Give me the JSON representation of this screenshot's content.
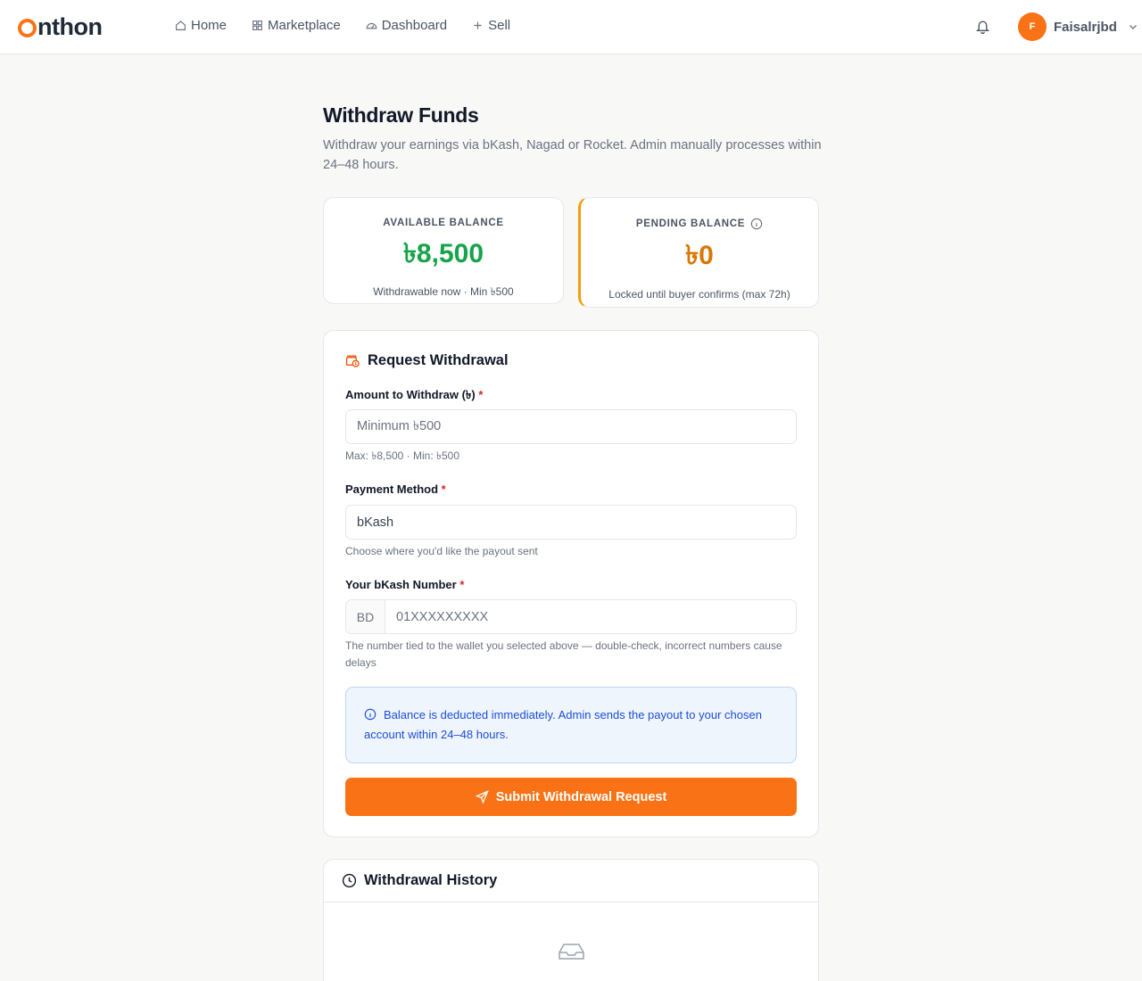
{
  "header": {
    "logo_rest": "nthon",
    "nav": [
      {
        "label": "Home",
        "icon": "home-icon"
      },
      {
        "label": "Marketplace",
        "icon": "grid-icon"
      },
      {
        "label": "Dashboard",
        "icon": "gauge-icon"
      },
      {
        "label": "Sell",
        "icon": "plus-icon"
      }
    ],
    "avatar_initial": "F",
    "user_name": "Faisalrjbd"
  },
  "page": {
    "title": "Withdraw Funds",
    "subtitle": "Withdraw your earnings via bKash, Nagad or Rocket. Admin manually processes within 24–48 hours."
  },
  "balances": {
    "available": {
      "label": "AVAILABLE BALANCE",
      "amount": "৳8,500",
      "note": "Withdrawable now · Min ৳500",
      "color": "#16a34a"
    },
    "pending": {
      "label": "PENDING BALANCE",
      "amount": "৳0",
      "note": "Locked until buyer confirms (max 72h)",
      "color": "#d97706",
      "accent": "#f59e0b"
    }
  },
  "form": {
    "title": "Request Withdrawal",
    "amount_label": "Amount to Withdraw (৳)",
    "amount_placeholder": "Minimum ৳500",
    "amount_hint": "Max: ৳8,500 · Min: ৳500",
    "method_label": "Payment Method",
    "method_value": "bKash",
    "method_hint": "Choose where you'd like the payout sent",
    "number_label": "Your bKash Number",
    "number_prefix": "BD",
    "number_placeholder": "01XXXXXXXXX",
    "number_hint": "The number tied to the wallet you selected above — double-check, incorrect numbers cause delays",
    "required_mark": "*",
    "notice": "Balance is deducted immediately. Admin sends the payout to your chosen account within 24–48 hours.",
    "submit_label": "Submit Withdrawal Request"
  },
  "history": {
    "title": "Withdrawal History"
  },
  "colors": {
    "brand": "#f97316",
    "info": "#1d4ed8"
  }
}
